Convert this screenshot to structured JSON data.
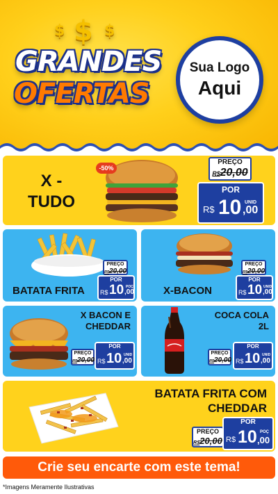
{
  "header": {
    "title_line1": "GRANDES",
    "title_line2": "OFERTAS",
    "dollar_signs": [
      "$",
      "$",
      "$"
    ],
    "logo_line1": "Sua Logo",
    "logo_line2": "Aqui"
  },
  "colors": {
    "hero_yellow": "#ffcf1a",
    "card_yellow": "#ffd21c",
    "card_blue": "#3db4f0",
    "price_blue": "#1e3fa0",
    "cta_orange": "#ff5a0a",
    "discount_red": "#e63b1e"
  },
  "products": [
    {
      "name_line1": "X -",
      "name_line2": "TUDO",
      "discount": "-50%",
      "preco_label": "PREÇO",
      "old_price_cur": "R$",
      "old_price": "20,00",
      "por_label": "POR",
      "cur": "R$",
      "price_int": "10",
      "price_cents": ",00",
      "unit": "UNID"
    },
    {
      "name": "BATATA FRITA",
      "preco_label": "PREÇO",
      "old_price_cur": "R$",
      "old_price": "20,00",
      "por_label": "POR",
      "cur": "R$",
      "price_int": "10",
      "price_cents": ",00",
      "unit": "POÇ"
    },
    {
      "name": "X-BACON",
      "preco_label": "PREÇO",
      "old_price_cur": "R$",
      "old_price": "20,00",
      "por_label": "POR",
      "cur": "R$",
      "price_int": "10",
      "price_cents": ",00",
      "unit": "UNID"
    },
    {
      "name_line1": "X BACON E",
      "name_line2": "CHEDDAR",
      "preco_label": "PREÇO",
      "old_price_cur": "R$",
      "old_price": "20,00",
      "por_label": "POR",
      "cur": "R$",
      "price_int": "10",
      "price_cents": ",00",
      "unit": "UNID"
    },
    {
      "name_line1": "COCA COLA",
      "name_line2": "2L",
      "preco_label": "PREÇO",
      "old_price_cur": "R$",
      "old_price": "20,00",
      "por_label": "POR",
      "cur": "R$",
      "price_int": "10",
      "price_cents": ",00",
      "unit": "UNID"
    },
    {
      "name_line1": "BATATA FRITA COM",
      "name_line2": "CHEDDAR",
      "preco_label": "PREÇO",
      "old_price_cur": "R$",
      "old_price": "20,00",
      "por_label": "POR",
      "cur": "R$",
      "price_int": "10",
      "price_cents": ",00",
      "unit": "POÇ"
    }
  ],
  "cta": {
    "label": "Crie seu encarte com este tema!"
  },
  "footnote": "*Imagens Meramente Ilustrativas"
}
